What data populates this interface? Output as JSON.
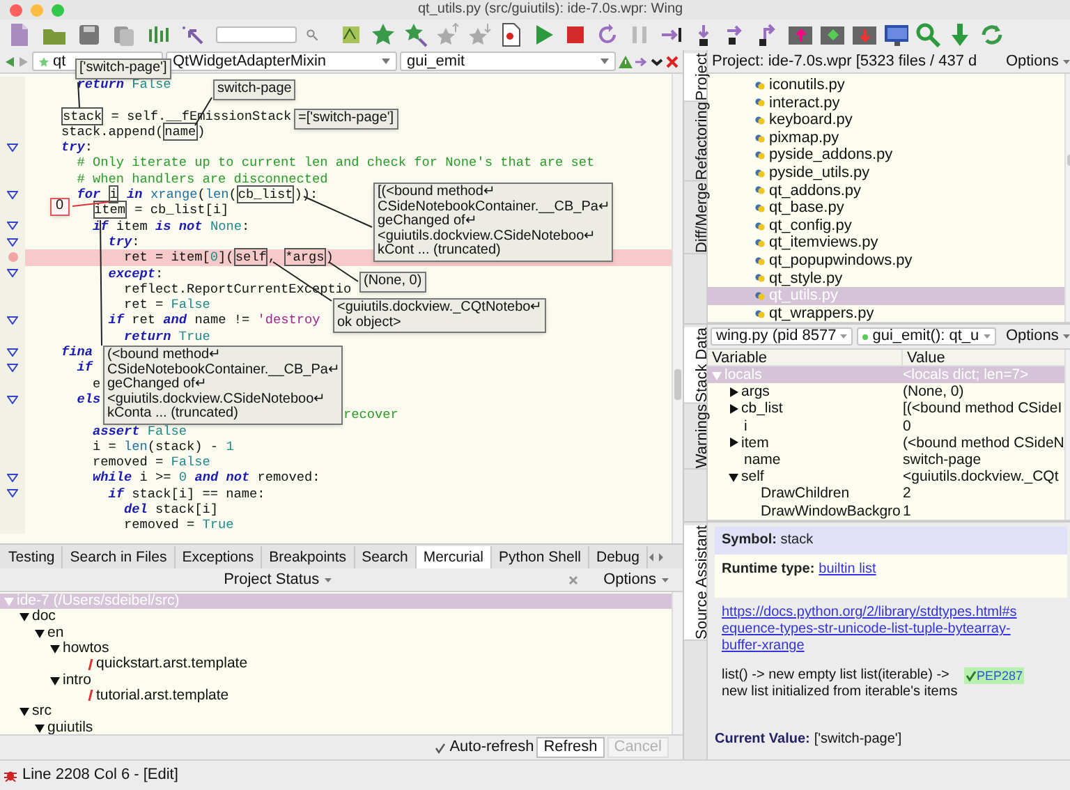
{
  "window": {
    "title": "qt_utils.py (src/guiutils): ide-7.0s.wpr: Wing"
  },
  "editor": {
    "file_menu": "qt",
    "class_menu": "QtWidgetAdapterMixin",
    "function_menu": "gui_emit",
    "lines": [
      {
        "fold": false,
        "breakpoint": false,
        "segments": [
          {
            "text": "  return",
            "kind": "keyword"
          },
          {
            "text": " False",
            "kind": "constant"
          }
        ]
      },
      {
        "fold": false,
        "breakpoint": false
      },
      {
        "fold": false,
        "breakpoint": false,
        "segments": [
          {
            "text": "stack",
            "kind": "boxed"
          },
          {
            "text": " = self.__fEmissionStack",
            "kind": "plain"
          }
        ]
      },
      {
        "fold": false,
        "breakpoint": false,
        "segments": [
          {
            "text": "stack.append(",
            "kind": "plain"
          },
          {
            "text": "name",
            "kind": "boxed"
          },
          {
            "text": ")",
            "kind": "plain"
          }
        ]
      },
      {
        "fold": true,
        "breakpoint": false,
        "segments": [
          {
            "text": "try",
            "kind": "keyword"
          },
          {
            "text": ":",
            "kind": "plain"
          }
        ]
      },
      {
        "fold": false,
        "breakpoint": false,
        "segments": [
          {
            "text": "  # Only iterate up to current len and check for None's that are set",
            "kind": "comment"
          }
        ]
      },
      {
        "fold": false,
        "breakpoint": false,
        "segments": [
          {
            "text": "  # when handlers are disconnected",
            "kind": "comment"
          }
        ]
      },
      {
        "fold": true,
        "breakpoint": false,
        "segments": [
          {
            "text": "  for ",
            "kind": "keyword"
          },
          {
            "text": "i",
            "kind": "boxed"
          },
          {
            "text": " in ",
            "kind": "keyword"
          },
          {
            "text": "xrange",
            "kind": "builtin"
          },
          {
            "text": "(",
            "kind": "plain"
          },
          {
            "text": "len",
            "kind": "builtin"
          },
          {
            "text": "(",
            "kind": "plain"
          },
          {
            "text": "cb_list",
            "kind": "boxed"
          },
          {
            "text": ")):",
            "kind": "plain"
          }
        ]
      },
      {
        "fold": false,
        "breakpoint": false,
        "segments": [
          {
            "text": "    item",
            "kind": "boxed"
          },
          {
            "text": " = cb_list[i]",
            "kind": "plain"
          }
        ]
      },
      {
        "fold": true,
        "breakpoint": false,
        "segments": [
          {
            "text": "    if",
            "kind": "keyword"
          },
          {
            "text": " item ",
            "kind": "plain"
          },
          {
            "text": "is not ",
            "kind": "keyword"
          },
          {
            "text": "None",
            "kind": "constant"
          },
          {
            "text": ":",
            "kind": "plain"
          }
        ]
      },
      {
        "fold": true,
        "breakpoint": false,
        "segments": [
          {
            "text": "      try",
            "kind": "keyword"
          },
          {
            "text": ":",
            "kind": "plain"
          }
        ]
      },
      {
        "fold": false,
        "breakpoint": true,
        "segments": [
          {
            "text": "        ret = item[",
            "kind": "plain"
          },
          {
            "text": "0",
            "kind": "constant"
          },
          {
            "text": "](",
            "kind": "plain"
          },
          {
            "text": "self",
            "kind": "boxed"
          },
          {
            "text": ", ",
            "kind": "plain"
          },
          {
            "text": "*args",
            "kind": "boxed"
          },
          {
            "text": ")",
            "kind": "plain"
          }
        ]
      },
      {
        "fold": true,
        "breakpoint": false,
        "segments": [
          {
            "text": "      except",
            "kind": "keyword"
          },
          {
            "text": ":",
            "kind": "plain"
          }
        ]
      },
      {
        "fold": false,
        "breakpoint": false,
        "segments": [
          {
            "text": "        reflect.ReportCurrentExceptio",
            "kind": "plain"
          }
        ]
      },
      {
        "fold": false,
        "breakpoint": false,
        "segments": [
          {
            "text": "        ret = ",
            "kind": "plain"
          },
          {
            "text": "False",
            "kind": "constant"
          }
        ]
      },
      {
        "fold": true,
        "breakpoint": false,
        "segments": [
          {
            "text": "      if",
            "kind": "keyword"
          },
          {
            "text": " ret ",
            "kind": "plain"
          },
          {
            "text": "and",
            "kind": "keyword"
          },
          {
            "text": " name != ",
            "kind": "plain"
          },
          {
            "text": "'destroy",
            "kind": "string"
          }
        ]
      },
      {
        "fold": false,
        "breakpoint": false,
        "segments": [
          {
            "text": "        return",
            "kind": "keyword"
          },
          {
            "text": " True",
            "kind": "constant"
          }
        ]
      },
      {
        "fold": true,
        "breakpoint": false,
        "segments": [
          {
            "text": "fina",
            "kind": "keyword"
          }
        ]
      },
      {
        "fold": true,
        "breakpoint": false,
        "segments": [
          {
            "text": "  if",
            "kind": "keyword"
          }
        ]
      },
      {
        "fold": false,
        "breakpoint": false,
        "segments": [
          {
            "text": "    e",
            "kind": "plain"
          }
        ]
      },
      {
        "fold": true,
        "breakpoint": false,
        "segments": [
          {
            "text": "  els",
            "kind": "keyword"
          }
        ]
      },
      {
        "fold": false,
        "breakpoint": false,
        "segments": [
          {
            "text": "                                    recover",
            "kind": "comment"
          }
        ]
      },
      {
        "fold": false,
        "breakpoint": false,
        "segments": [
          {
            "text": "    assert",
            "kind": "keyword"
          },
          {
            "text": " False",
            "kind": "constant"
          }
        ]
      },
      {
        "fold": false,
        "breakpoint": false,
        "segments": [
          {
            "text": "    i = ",
            "kind": "plain"
          },
          {
            "text": "len",
            "kind": "builtin"
          },
          {
            "text": "(stack) - ",
            "kind": "plain"
          },
          {
            "text": "1",
            "kind": "constant"
          }
        ]
      },
      {
        "fold": false,
        "breakpoint": false,
        "segments": [
          {
            "text": "    removed = ",
            "kind": "plain"
          },
          {
            "text": "False",
            "kind": "constant"
          }
        ]
      },
      {
        "fold": true,
        "breakpoint": false,
        "segments": [
          {
            "text": "    while",
            "kind": "keyword"
          },
          {
            "text": " i >= ",
            "kind": "plain"
          },
          {
            "text": "0",
            "kind": "constant"
          },
          {
            "text": " and not",
            "kind": "keyword"
          },
          {
            "text": " removed:",
            "kind": "plain"
          }
        ]
      },
      {
        "fold": true,
        "breakpoint": false,
        "segments": [
          {
            "text": "      if",
            "kind": "keyword"
          },
          {
            "text": " stack[i] == name:",
            "kind": "plain"
          }
        ]
      },
      {
        "fold": false,
        "breakpoint": false,
        "segments": [
          {
            "text": "        del",
            "kind": "keyword"
          },
          {
            "text": " stack[i]",
            "kind": "plain"
          }
        ]
      },
      {
        "fold": false,
        "breakpoint": false,
        "segments": [
          {
            "text": "        removed = ",
            "kind": "plain"
          },
          {
            "text": "True",
            "kind": "constant"
          }
        ]
      }
    ],
    "tooltips": [
      {
        "kind": "value",
        "text": "['switch-page']"
      },
      {
        "kind": "value",
        "text": "switch-page"
      },
      {
        "kind": "value",
        "text": "=['switch-page']"
      },
      {
        "kind": "alert",
        "text": "0"
      },
      {
        "kind": "value",
        "text": "[(<bound method↵\nCSideNotebookContainer.__CB_Pa↵\ngeChanged of↵\n<guiutils.dockview.CSideNoteboo↵\nkCont ... (truncated)"
      },
      {
        "kind": "value",
        "text": "(None, 0)"
      },
      {
        "kind": "value",
        "text": "<guiutils.dockview._CQtNotebo↵\nok object>"
      },
      {
        "kind": "value",
        "text": "(<bound method↵\nCSideNotebookContainer.__CB_Pa↵\ngeChanged of↵\n<guiutils.dockview.CSideNoteboo↵\nkConta ... (truncated)"
      }
    ]
  },
  "bottom_panel": {
    "tabs": [
      {
        "label": "Testing",
        "selected": false
      },
      {
        "label": "Search in Files",
        "selected": false
      },
      {
        "label": "Exceptions",
        "selected": false
      },
      {
        "label": "Breakpoints",
        "selected": false
      },
      {
        "label": "Search",
        "selected": false
      },
      {
        "label": "Mercurial",
        "selected": true
      },
      {
        "label": "Python Shell",
        "selected": false
      },
      {
        "label": "Debug",
        "selected": false
      }
    ],
    "title": "Project Status",
    "options": "Options",
    "tree": [
      {
        "label": "ide-7 (/Users/sdeibel/src)",
        "selected": true,
        "expanded": true,
        "modified": false,
        "children": [
          {
            "label": "doc",
            "selected": false,
            "expanded": true,
            "modified": false,
            "children": [
              {
                "label": "en",
                "selected": false,
                "expanded": true,
                "modified": false,
                "children": [
                  {
                    "label": "howtos",
                    "selected": false,
                    "expanded": true,
                    "modified": false,
                    "children": [
                      {
                        "label": "quickstart.arst.template",
                        "selected": false,
                        "modified": true
                      }
                    ]
                  },
                  {
                    "label": "intro",
                    "selected": false,
                    "expanded": true,
                    "modified": false,
                    "children": [
                      {
                        "label": "tutorial.arst.template",
                        "selected": false,
                        "modified": true
                      }
                    ]
                  }
                ]
              }
            ]
          },
          {
            "label": "src",
            "selected": false,
            "expanded": true,
            "modified": false,
            "children": [
              {
                "label": "guiutils",
                "selected": false,
                "expanded": true,
                "modified": false
              }
            ]
          }
        ]
      }
    ],
    "auto_refresh": {
      "label": "Auto-refresh",
      "checked": true
    },
    "buttons": [
      {
        "label": "Refresh",
        "disabled": false
      },
      {
        "label": "Cancel",
        "disabled": true
      }
    ]
  },
  "project_panel": {
    "tabs": [
      {
        "label": "Project",
        "selected": true
      },
      {
        "label": "Refactoring",
        "selected": false
      },
      {
        "label": "Diff/Merge",
        "selected": false
      }
    ],
    "title": "Project: ide-7.0s.wpr [5323 files / 437 d",
    "options": "Options",
    "files": [
      {
        "name": "iconutils.py",
        "selected": false
      },
      {
        "name": "interact.py",
        "selected": false
      },
      {
        "name": "keyboard.py",
        "selected": false
      },
      {
        "name": "pixmap.py",
        "selected": false
      },
      {
        "name": "pyside_addons.py",
        "selected": false
      },
      {
        "name": "pyside_utils.py",
        "selected": false
      },
      {
        "name": "qt_addons.py",
        "selected": false
      },
      {
        "name": "qt_base.py",
        "selected": false
      },
      {
        "name": "qt_config.py",
        "selected": false
      },
      {
        "name": "qt_itemviews.py",
        "selected": false
      },
      {
        "name": "qt_popupwindows.py",
        "selected": false
      },
      {
        "name": "qt_style.py",
        "selected": false
      },
      {
        "name": "qt_utils.py",
        "selected": true
      },
      {
        "name": "qt_wrappers.py",
        "selected": false
      }
    ]
  },
  "stack_panel": {
    "tabs": [
      {
        "label": "Stack Data",
        "selected": true
      },
      {
        "label": "Warnings",
        "selected": false
      }
    ],
    "process": "wing.py (pid 8577",
    "frame": "gui_emit(): qt_u",
    "options": "Options",
    "columns": [
      "Variable",
      "Value"
    ],
    "rows": [
      {
        "name": "locals",
        "value": "<locals dict; len=7>",
        "selected": true,
        "expanded": true,
        "children": [
          {
            "name": "args",
            "value": "(None, 0)",
            "selected": false,
            "expanded": false
          },
          {
            "name": "cb_list",
            "value": "[(<bound method CSideI",
            "selected": false,
            "expanded": false
          },
          {
            "name": "i",
            "value": "0",
            "selected": false
          },
          {
            "name": "item",
            "value": "(<bound method CSideN",
            "selected": false,
            "expanded": false
          },
          {
            "name": "name",
            "value": "switch-page",
            "selected": false
          },
          {
            "name": "self",
            "value": "<guiutils.dockview._CQt",
            "selected": false,
            "expanded": true,
            "children": [
              {
                "name": "DrawChildren",
                "value": "2",
                "selected": false
              },
              {
                "name": "DrawWindowBackgro",
                "value": "1",
                "selected": false
              }
            ]
          }
        ]
      }
    ]
  },
  "assistant_panel": {
    "tabs": [
      {
        "label": "Source Assistant",
        "selected": true
      }
    ],
    "symbol": "**Symbol:** stack",
    "runtime_label": "Runtime type:",
    "runtime_link": "builtin list",
    "doc_url": "https://docs.python.org/2/library/stdtypes.html#sequence-types-str-unicode-list-tuple-bytearray-buffer-xrange",
    "description": "list() -> new empty list list(iterable) -> new list initialized from iterable's items",
    "badge": "PEP287",
    "current_label": "Current Value:",
    "current_value": "['switch-page']"
  },
  "status_bar": {
    "text": "Line 2208 Col 6 - [Edit]"
  }
}
